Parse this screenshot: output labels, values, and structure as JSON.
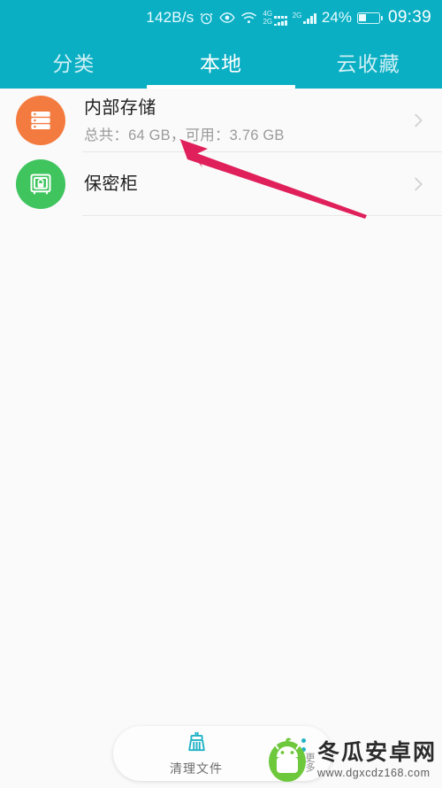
{
  "statusbar": {
    "network_speed": "142B/s",
    "alarm_icon": "alarm-clock-icon",
    "eye_icon": "eye-icon",
    "wifi_icon": "wifi-icon",
    "sim1_label_top": "4G",
    "sim1_label_bottom": "2G",
    "sim2_label": "2G",
    "battery_percent": "24%",
    "battery_icon": "battery-icon",
    "time": "09:39"
  },
  "colors": {
    "header_teal": "#0aafc4",
    "tab_active": "#ffffff",
    "tab_inactive": "#cdeff5",
    "body_bg": "#fafafa",
    "icon_orange": "#f47b3f",
    "icon_green": "#3fc45e",
    "annotation_red": "#e0205a",
    "accent_cyan": "#22b3c6"
  },
  "tabs": [
    {
      "label": "分类",
      "active": false
    },
    {
      "label": "本地",
      "active": true
    },
    {
      "label": "云收藏",
      "active": false
    }
  ],
  "list": [
    {
      "icon": "server-storage-icon",
      "title": "内部存储",
      "subtitle": "总共：64 GB，可用：3.76 GB",
      "chevron": "chevron-right-icon"
    },
    {
      "icon": "safe-lock-icon",
      "title": "保密柜",
      "subtitle": "",
      "chevron": "chevron-right-icon"
    }
  ],
  "bottom_bar": {
    "clean_label": "清理文件",
    "clean_icon": "broom-icon",
    "more_icon": "more-vertical-icon",
    "side_text": "更多"
  },
  "watermark": {
    "name": "冬瓜安卓网",
    "url": "www.dgxcdz168.com",
    "logo": "android-melon-logo"
  },
  "annotation": {
    "type": "arrow",
    "color": "#e0205a"
  }
}
